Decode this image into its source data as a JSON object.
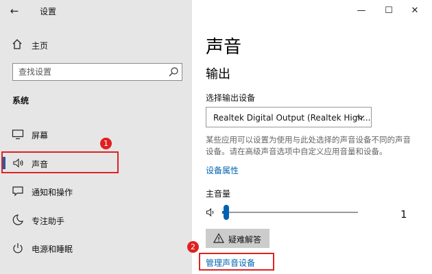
{
  "window": {
    "title": "设置",
    "controls": {
      "minimize_icon": "minimize-icon",
      "maximize_icon": "maximize-icon",
      "close_icon": "close-icon"
    }
  },
  "sidebar": {
    "home_label": "主页",
    "search": {
      "placeholder": "查找设置"
    },
    "section_label": "系统",
    "items": [
      {
        "label": "屏幕",
        "icon": "monitor-icon"
      },
      {
        "label": "声音",
        "icon": "speaker-icon",
        "active": true
      },
      {
        "label": "通知和操作",
        "icon": "notification-icon"
      },
      {
        "label": "专注助手",
        "icon": "moon-icon"
      },
      {
        "label": "电源和睡眠",
        "icon": "power-icon"
      }
    ]
  },
  "annotations": {
    "badge1": "1",
    "badge2": "2",
    "color": "#e02020"
  },
  "main": {
    "title": "声音",
    "output": {
      "heading": "输出",
      "device_label": "选择输出设备",
      "device_value": "Realtek Digital Output (Realtek High...",
      "description": "某些应用可以设置为使用与此处选择的声音设备不同的声音设备。请在高级声音选项中自定义应用音量和设备。",
      "device_properties_link": "设备属性",
      "master_volume_label": "主音量",
      "volume_value": "1",
      "volume_fraction": 0.01,
      "troubleshoot_button": "疑难解答",
      "manage_devices_link": "管理声音设备"
    }
  },
  "colors": {
    "accent": "#0063b1",
    "sidebar_bg": "#e6e6e6",
    "active_bar": "#2c5aa0"
  }
}
